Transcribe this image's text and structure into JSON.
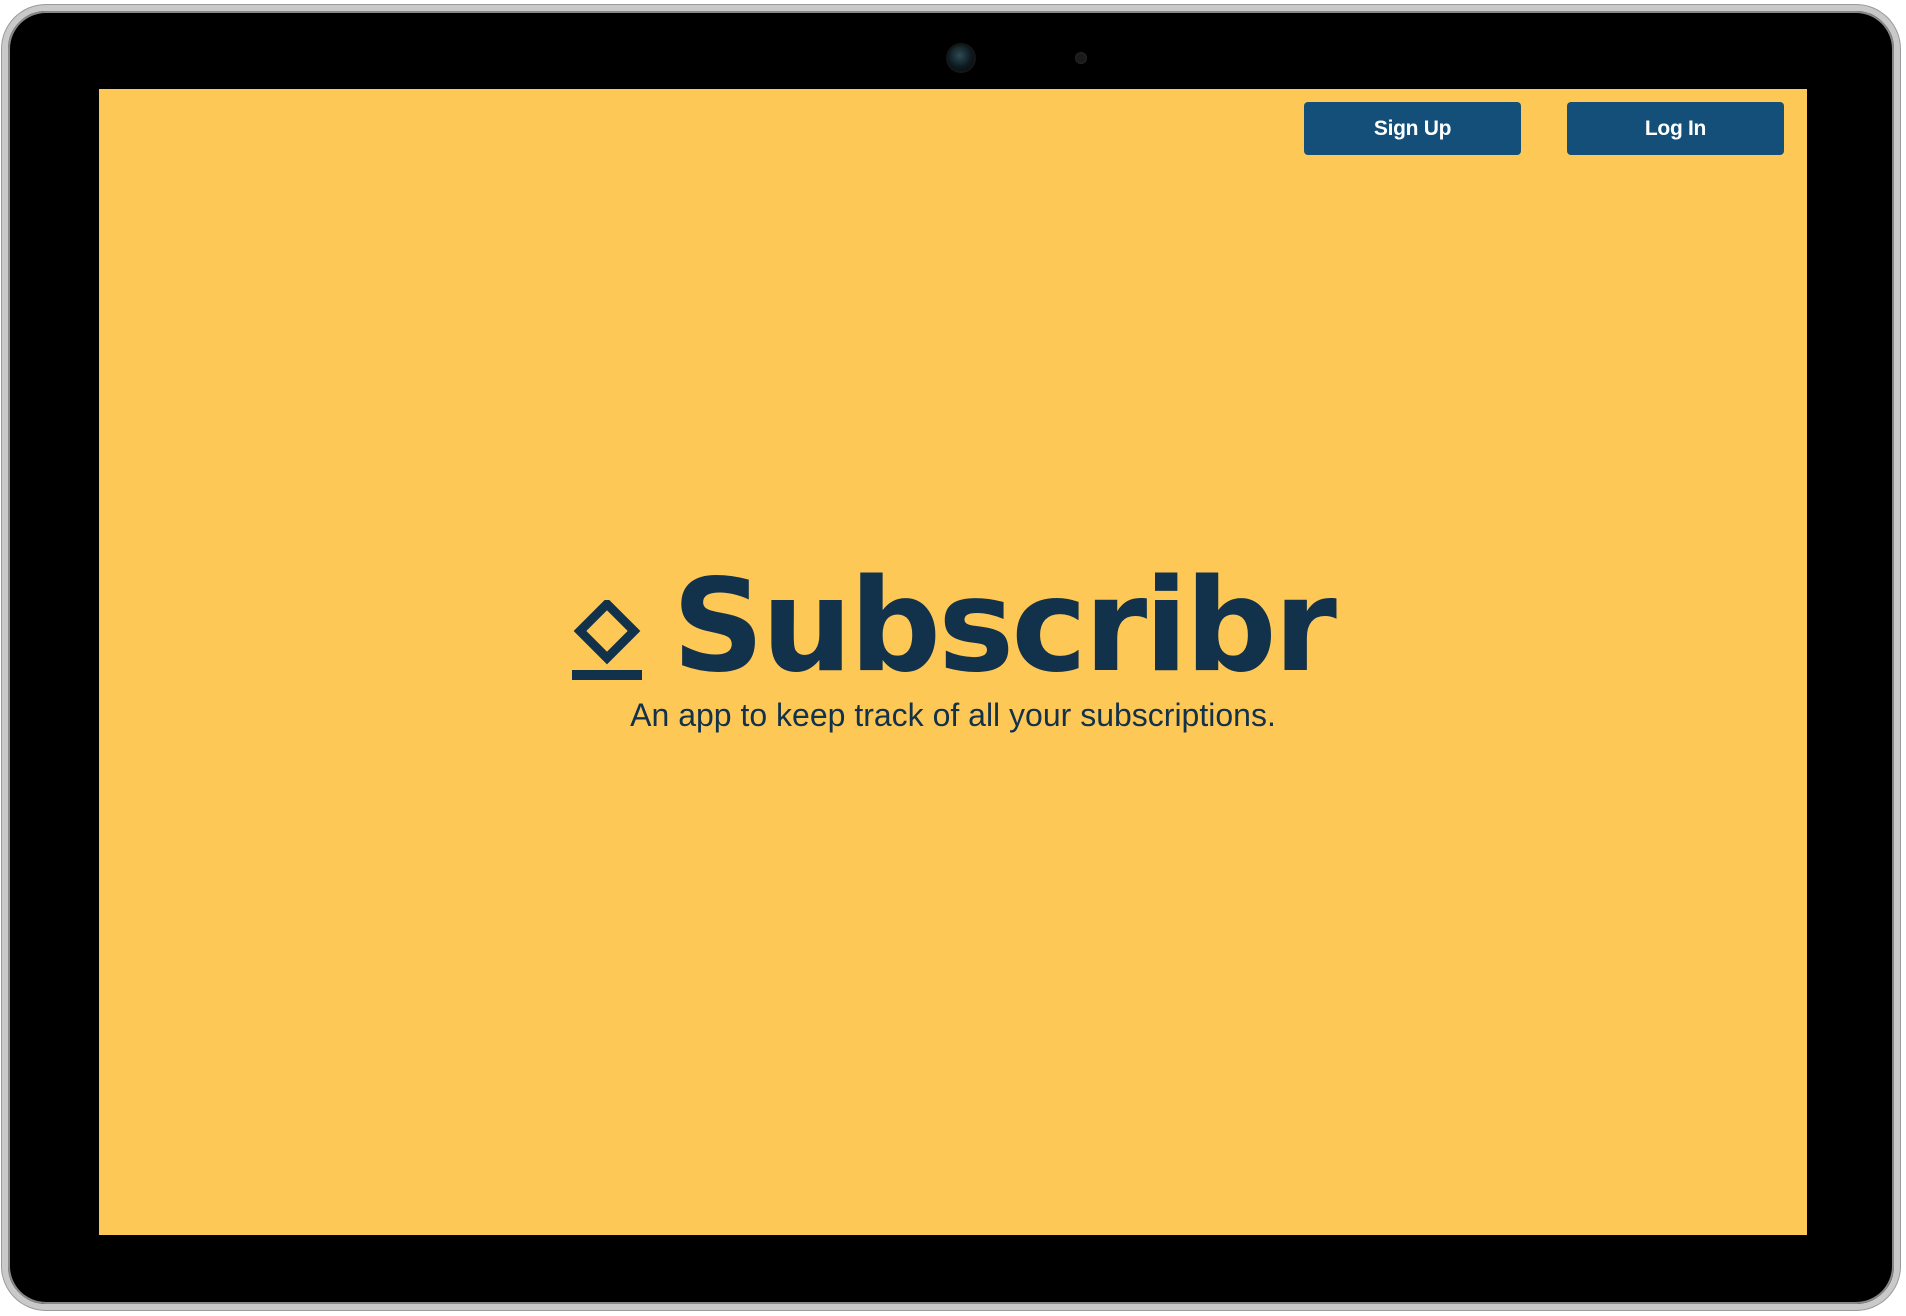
{
  "header": {
    "signup_label": "Sign Up",
    "login_label": "Log In"
  },
  "hero": {
    "brand_name": "Subscribr",
    "tagline": "An app to keep track of all your subscriptions."
  },
  "colors": {
    "background": "#FEC857",
    "button": "#144F79",
    "brand_text": "#12314A"
  },
  "icons": {
    "logo": "diamond-over-line-icon"
  }
}
